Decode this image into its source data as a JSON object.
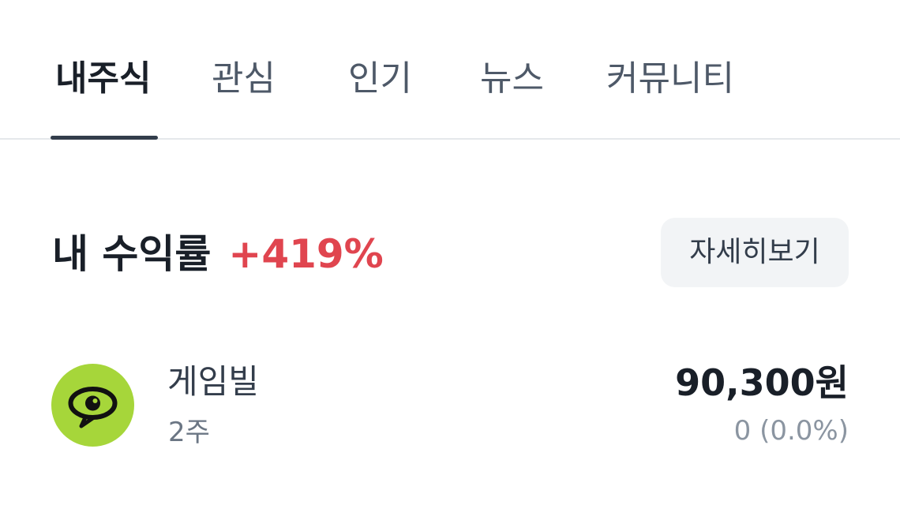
{
  "tabs": [
    {
      "label": "내주식",
      "active": true
    },
    {
      "label": "관심",
      "active": false
    },
    {
      "label": "인기",
      "active": false
    },
    {
      "label": "뉴스",
      "active": false
    },
    {
      "label": "커뮤니티",
      "active": false
    }
  ],
  "summary": {
    "title": "내 수익률",
    "return_value": "+419%",
    "detail_button_label": "자세히보기"
  },
  "holdings": [
    {
      "name": "게임빌",
      "quantity": "2주",
      "price": "90,300원",
      "change": "0 (0.0%)",
      "logo_icon": "eye-speech-bubble-icon",
      "logo_color": "#a6d63a"
    }
  ],
  "colors": {
    "accent_red": "#e0454f",
    "text_primary": "#191f28",
    "text_secondary": "#6b7684",
    "button_background": "#f2f4f6",
    "tab_indicator": "#333d4b"
  }
}
